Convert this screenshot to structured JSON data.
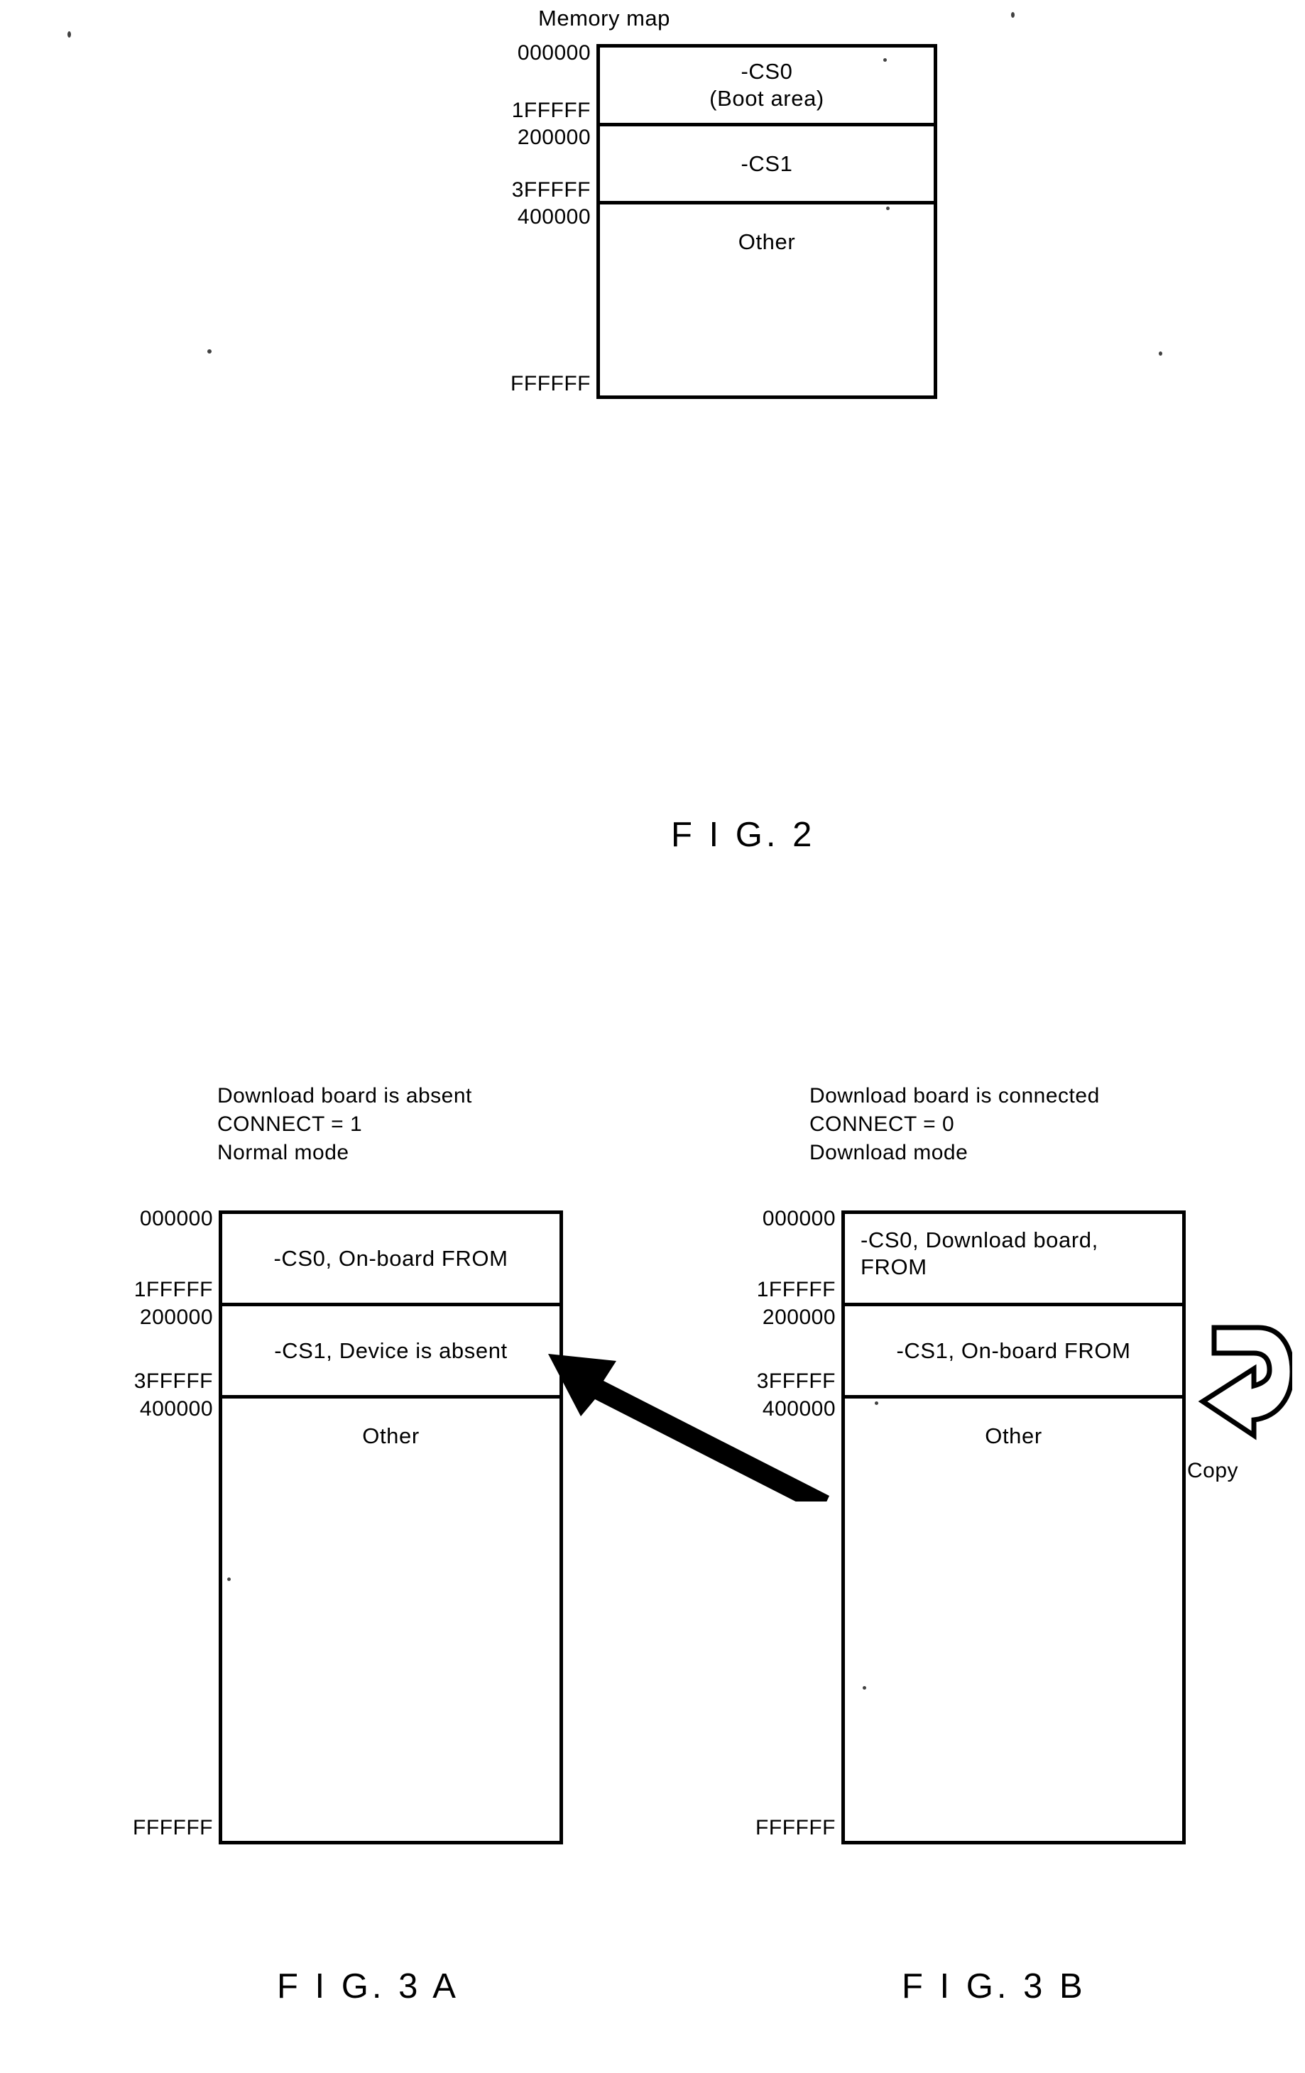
{
  "figure2": {
    "title": "Memory map",
    "caption": "F I G. 2",
    "addresses": {
      "start": "000000",
      "cs0_end": "1FFFFF",
      "cs1_start": "200000",
      "cs1_end": "3FFFFF",
      "other_start": "400000",
      "end": "FFFFFF"
    },
    "rows": [
      {
        "label": "-CS0\n(Boot area)"
      },
      {
        "label": "-CS1"
      },
      {
        "label": "Other"
      }
    ]
  },
  "figure3a": {
    "caption": "F I G. 3 A",
    "heading": {
      "line1": "Download board is absent",
      "line2": "CONNECT = 1",
      "line3": "Normal mode"
    },
    "addresses": {
      "start": "000000",
      "cs0_end": "1FFFFF",
      "cs1_start": "200000",
      "cs1_end": "3FFFFF",
      "other_start": "400000",
      "end": "FFFFFF"
    },
    "rows": [
      {
        "label": "-CS0, On-board FROM"
      },
      {
        "label": "-CS1, Device is absent"
      },
      {
        "label": "Other"
      }
    ]
  },
  "figure3b": {
    "caption": "F I G. 3 B",
    "heading": {
      "line1": "Download board is connected",
      "line2": "CONNECT = 0",
      "line3": "Download mode"
    },
    "addresses": {
      "start": "000000",
      "cs0_end": "1FFFFF",
      "cs1_start": "200000",
      "cs1_end": "3FFFFF",
      "other_start": "400000",
      "end": "FFFFFF"
    },
    "rows": [
      {
        "label": "-CS0, Download board,\nFROM"
      },
      {
        "label": "-CS1, On-board FROM"
      },
      {
        "label": "Other"
      }
    ],
    "copy_arrow_label": "Copy"
  },
  "colors": {
    "ink": "#000000",
    "paper": "#ffffff"
  }
}
